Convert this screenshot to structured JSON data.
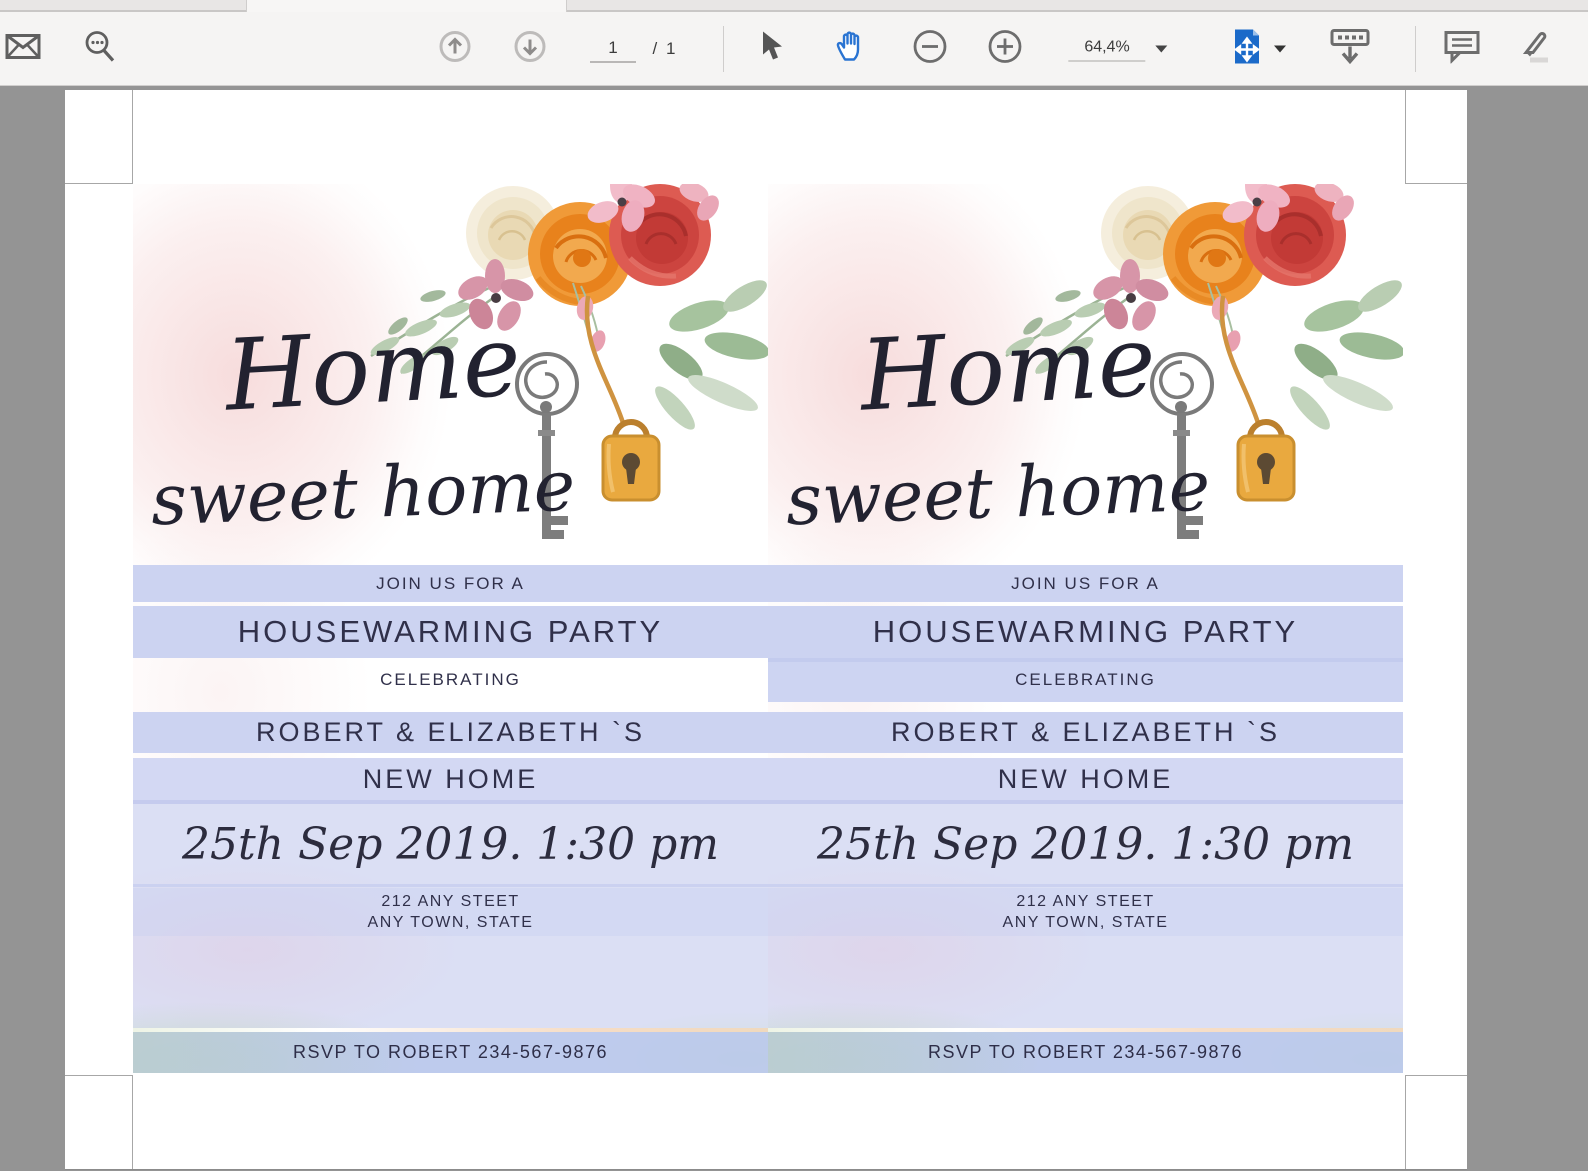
{
  "app": {
    "kind": "pdf-viewer"
  },
  "toolbar": {
    "page_current": "1",
    "page_total_label": "/ 1",
    "zoom_value": "64,4%",
    "icons": [
      "envelope",
      "search",
      "page-up",
      "page-down",
      "select-tool",
      "hand-tool",
      "zoom-out",
      "zoom-in",
      "fit-page",
      "scroll-mode",
      "comment",
      "highlight"
    ]
  },
  "document": {
    "invitation": {
      "headline_word1": "Home",
      "headline_word2": "sweet home",
      "join_line": "JOIN US FOR A",
      "event_line": "HOUSEWARMING PARTY",
      "celebrating_line": "CELEBRATING",
      "names_line": "ROBERT & ELIZABETH `S",
      "new_home_line": "NEW HOME",
      "date_line": "25th Sep 2019. 1:30 pm",
      "address_line1": "212 ANY STEET",
      "address_line2": "ANY TOWN, STATE",
      "rsvp_line": "RSVP TO ROBERT 234-567-9876"
    }
  },
  "colors": {
    "field_highlight": "#ccd3f1",
    "field_highlight_light": "#dbdff4",
    "toolbar_accent_blue": "#1b6ac9",
    "workspace_gray": "#949494",
    "lock_orange": "#e9a93f",
    "rose_red": "#d85048",
    "rose_orange": "#ef9433",
    "text_navy": "#30304a"
  }
}
